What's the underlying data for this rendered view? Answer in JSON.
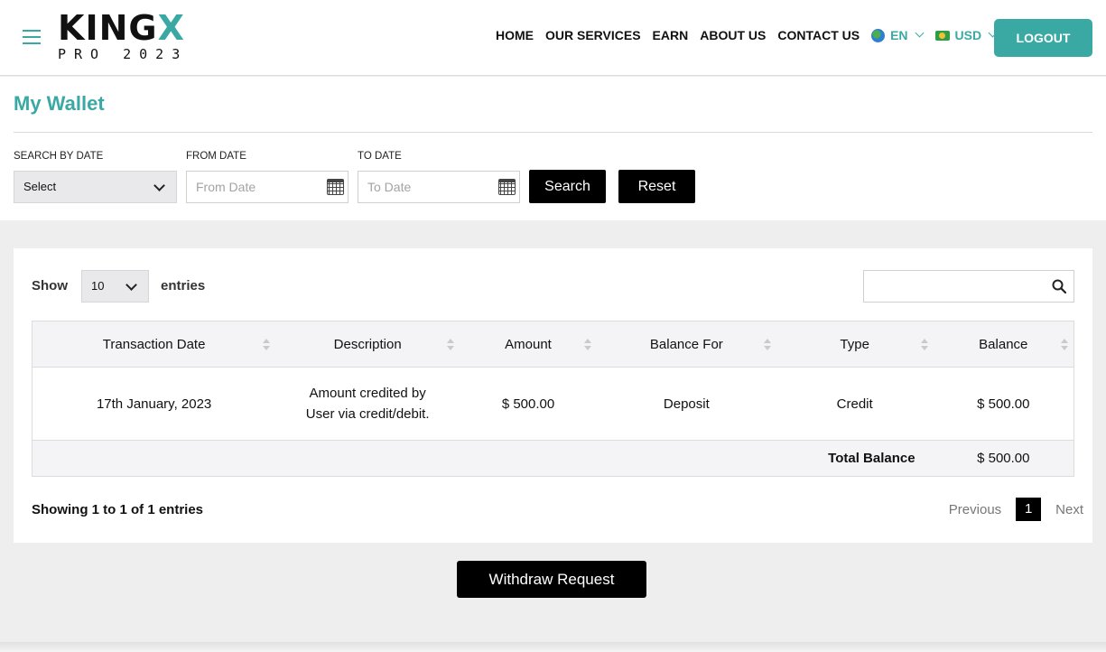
{
  "header": {
    "logo_main": "KING",
    "logo_x": "X",
    "logo_sub": "PRO 2023",
    "nav": [
      "HOME",
      "OUR SERVICES",
      "EARN",
      "ABOUT US",
      "CONTACT US"
    ],
    "language": "EN",
    "currency": "USD",
    "logout_label": "LOGOUT",
    "accent_color": "#3aa9a4"
  },
  "page": {
    "title": "My Wallet"
  },
  "filter": {
    "search_by_date_label": "SEARCH BY DATE",
    "search_by_date_value": "Select",
    "from_date_label": "FROM DATE",
    "from_date_placeholder": "From Date",
    "to_date_label": "TO DATE",
    "to_date_placeholder": "To Date",
    "search_label": "Search",
    "reset_label": "Reset"
  },
  "table_controls": {
    "show_label": "Show",
    "entries_value": "10",
    "entries_label": "entries",
    "search_value": ""
  },
  "table": {
    "columns": [
      "Transaction Date",
      "Description",
      "Amount",
      "Balance For",
      "Type",
      "Balance"
    ],
    "rows": [
      {
        "date": "17th January, 2023",
        "description_line1": "Amount credited by",
        "description_line2": "User via credit/debit.",
        "amount": "$ 500.00",
        "balance_for": "Deposit",
        "type": "Credit",
        "balance": "$ 500.00"
      }
    ],
    "total_label": "Total Balance",
    "total_value": "$ 500.00"
  },
  "pagination": {
    "info": "Showing 1 to 1 of 1 entries",
    "previous": "Previous",
    "current": "1",
    "next": "Next"
  },
  "withdraw_label": "Withdraw Request"
}
